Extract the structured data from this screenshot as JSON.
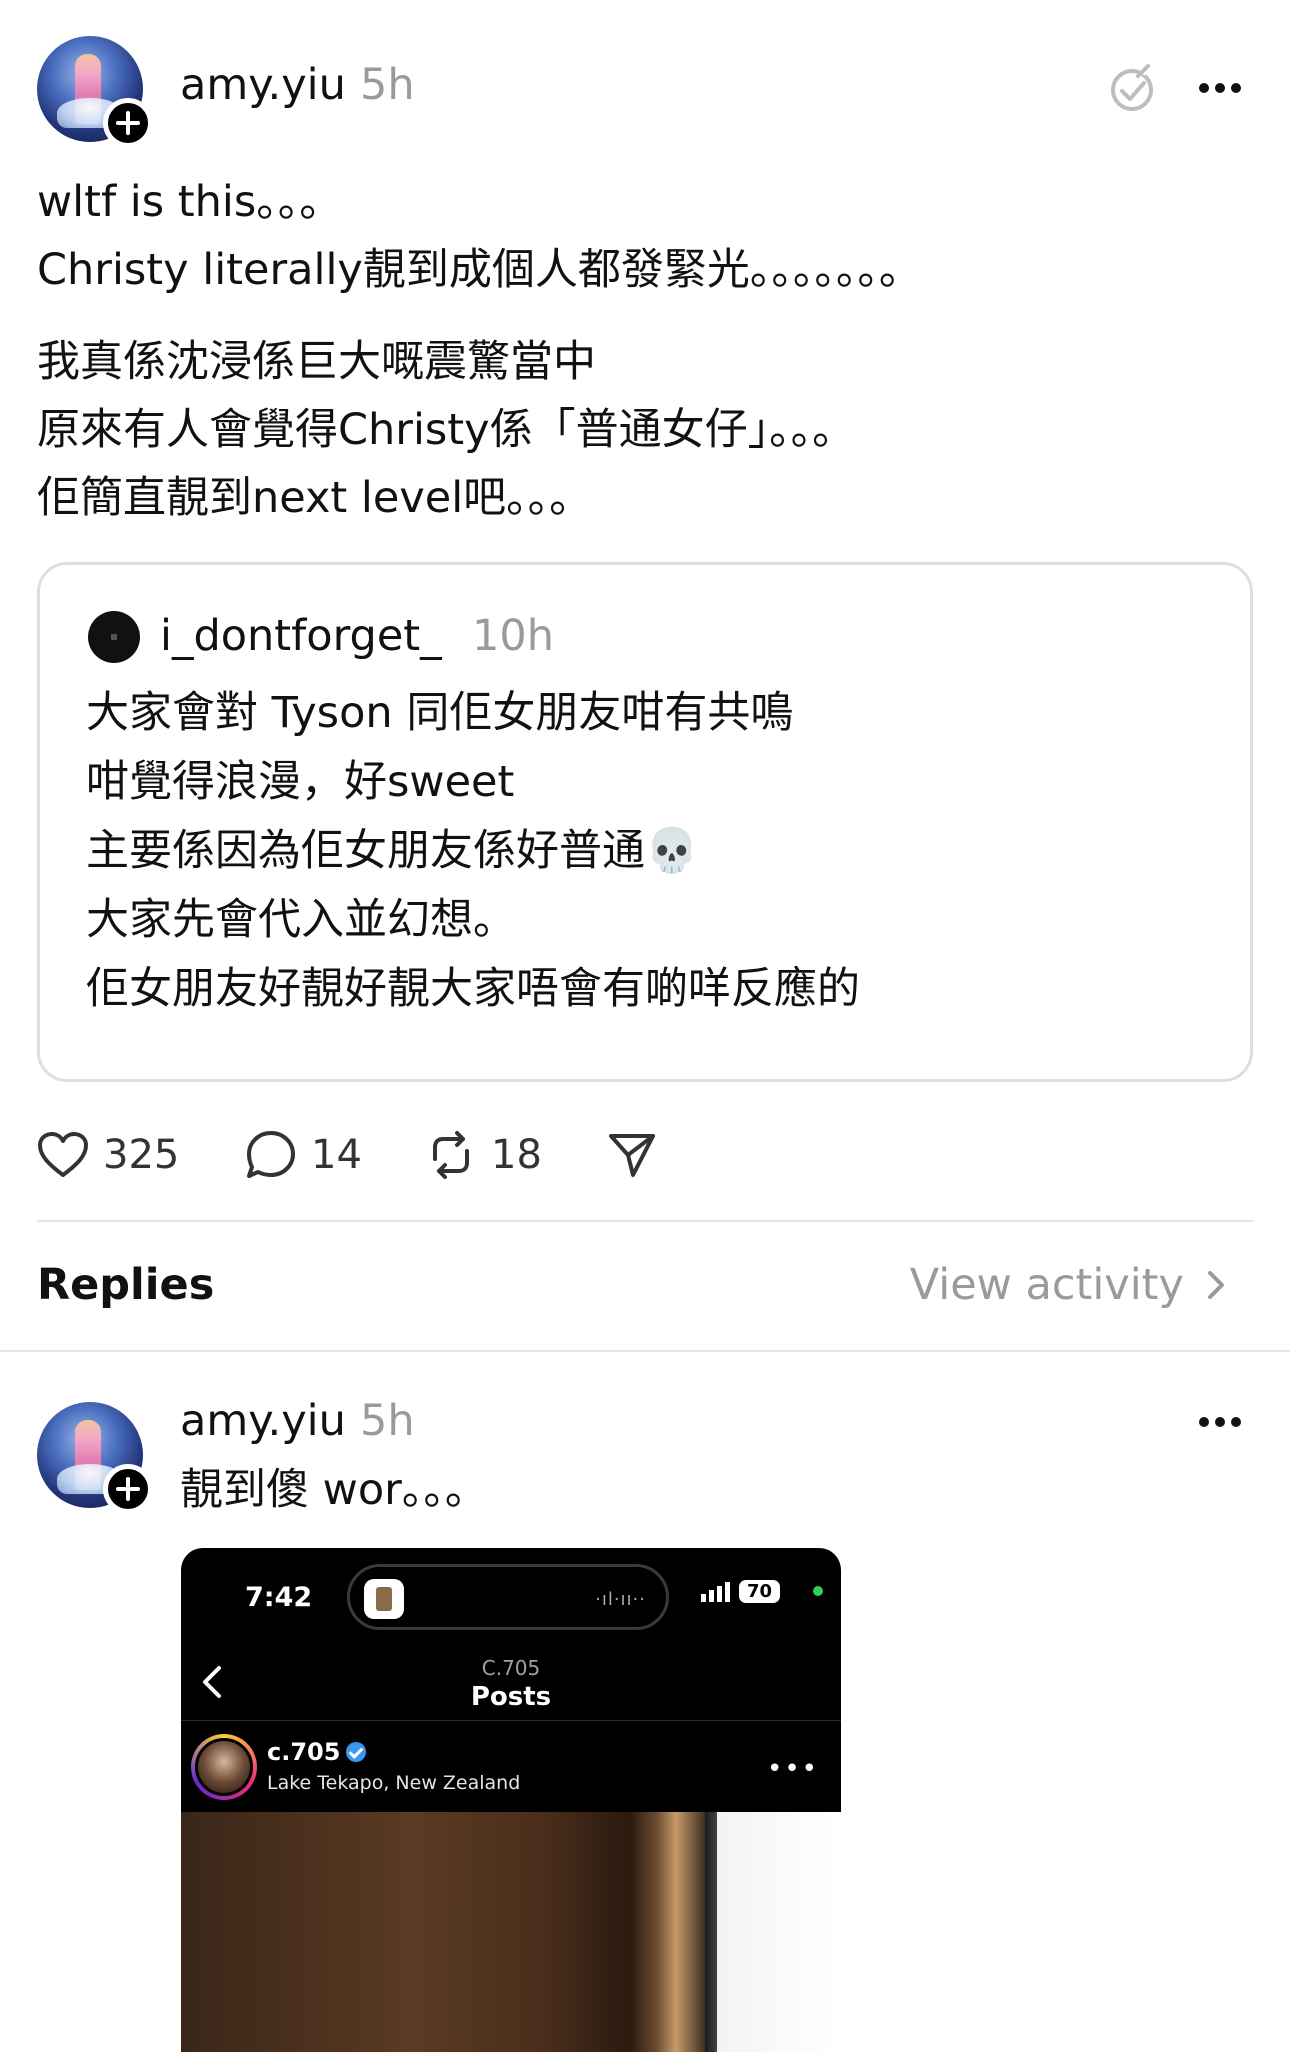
{
  "post": {
    "username": "amy.yiu",
    "time": "5h",
    "lines_1": [
      "wltf is this。。。",
      "Christy literally靚到成個人都發緊光。。。。。。。"
    ],
    "lines_2": [
      "我真係沈浸係巨大嘅震驚當中",
      "原來有人會覺得Christy係「普通女仔」。。。",
      "佢簡直靚到next level吧。。。"
    ]
  },
  "quote": {
    "username": "i_dontforget_",
    "time": "10h",
    "lines": [
      "大家會對 Tyson 同佢女朋友咁有共鳴",
      "咁覺得浪漫，好sweet",
      "主要係因為佢女朋友係好普通💀",
      "大家先會代入並幻想。",
      "佢女朋友好靚好靚大家唔會有啲咩反應的"
    ]
  },
  "actions": {
    "likes": "325",
    "comments": "14",
    "reposts": "18"
  },
  "replies_section": {
    "label": "Replies",
    "view_activity": "View activity"
  },
  "reply": {
    "username": "amy.yiu",
    "time": "5h",
    "text": "靚到傻 wor。。。"
  },
  "embedded_screenshot": {
    "clock": "7:42",
    "battery": "70",
    "handle": "C.705",
    "title": "Posts",
    "account_name": "c.705",
    "location": "Lake Tekapo, New Zealand"
  }
}
